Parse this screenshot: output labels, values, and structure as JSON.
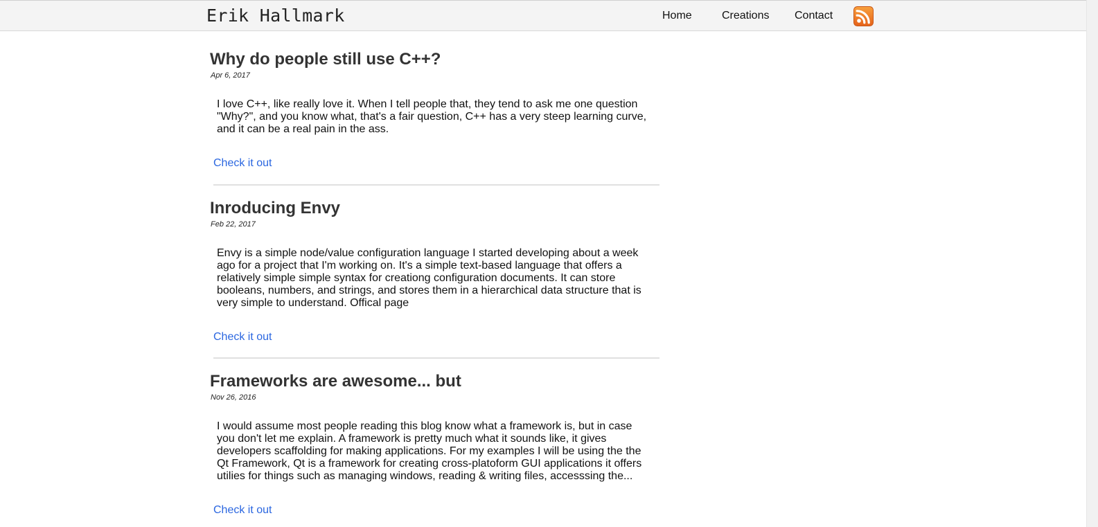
{
  "header": {
    "site_title": "Erik Hallmark",
    "nav": {
      "home": "Home",
      "creations": "Creations",
      "contact": "Contact"
    },
    "rss_icon": "rss-feed-icon",
    "rss_color": "#f07b1f"
  },
  "posts": [
    {
      "title": "Why do people still use C++?",
      "date": "Apr 6, 2017",
      "excerpt": "I love C++, like really love it. When I tell people that, they tend to ask me one question \"Why?\", and you know what, that's a fair question, C++ has a very steep learning curve, and it can be a real pain in the ass.",
      "link_label": "Check it out"
    },
    {
      "title": "Inroducing Envy",
      "date": "Feb 22, 2017",
      "excerpt": "Envy is a simple node/value configuration language I started developing about a week ago for a project that I'm working on. It's a simple text-based language that offers a relatively simple simple syntax for creationg configuration documents. It can store booleans, numbers, and strings, and stores them in a hierarchical data structure that is very simple to understand. Offical page",
      "link_label": "Check it out"
    },
    {
      "title": "Frameworks are awesome... but",
      "date": "Nov 26, 2016",
      "excerpt": "I would assume most people reading this blog know what a framework is, but in case you don't let me explain. A framework is pretty much what it sounds like, it gives developers scaffolding for making applications. For my examples I will be using the the Qt Framework, Qt is a framework for creating cross-platoform GUI applications it offers utilies for things such as managing windows, reading & writing files, accesssing the...",
      "link_label": "Check it out"
    }
  ],
  "colors": {
    "link": "#2a66e0",
    "header_bg": "#f4f4f4",
    "title": "#333333"
  }
}
